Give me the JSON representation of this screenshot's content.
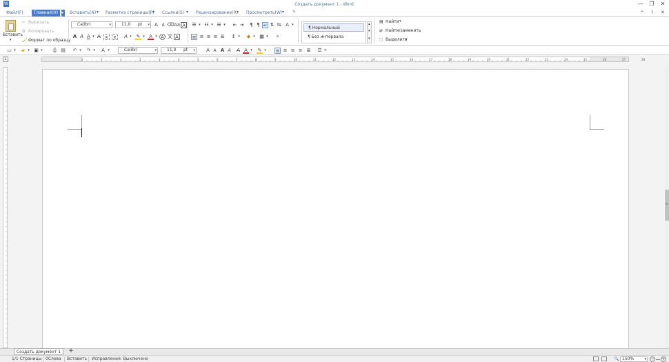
{
  "window": {
    "title": "Создать документ 1 - Word",
    "min": "—",
    "restore": "❐",
    "close": "✕",
    "ribbon_collapse": "^",
    "help": "?"
  },
  "menu": {
    "items": [
      "Файл(F)",
      "Главная(H)",
      "Вставить(N)",
      "Разметка страницы(P)",
      "Ссылки(S)",
      "Рецензирование(R)",
      "Просмотреть(W)"
    ],
    "active_index": 1
  },
  "ribbon": {
    "paste": "Вставить",
    "cut": "Вырезать",
    "copy": "Копировать",
    "format_painter": "Формат по образцу",
    "font": "Calibri",
    "size": "11,0",
    "unit": "pt",
    "styles": [
      "Нормальный",
      "Без интервала"
    ],
    "find": "Найти",
    "replace": "Найти/заменить",
    "select": "Выделить"
  },
  "qat": {
    "font": "Calibri",
    "size": "11,0",
    "unit": "pt"
  },
  "ruler": {
    "ticks": [
      "2",
      "1",
      "1",
      "2",
      "3",
      "4",
      "5",
      "6",
      "7",
      "8",
      "9",
      "10",
      "11",
      "12",
      "13",
      "14",
      "15",
      "16",
      "17",
      "18",
      "19",
      "20",
      "21",
      "22",
      "23",
      "24",
      "25",
      "26",
      "27",
      "28"
    ]
  },
  "tabs": {
    "doc": "Создать документ 1",
    "add": "+"
  },
  "status": {
    "pages": "1/1 Страницы",
    "words": "0Слова",
    "mode": "Вставить",
    "track": "Исправления: Выключено",
    "zoom": "150%"
  },
  "colors": {
    "accent": "#4a7ac9",
    "title": "#4a6fa5",
    "highlight": "#f5d400",
    "font_color": "#d42020"
  }
}
